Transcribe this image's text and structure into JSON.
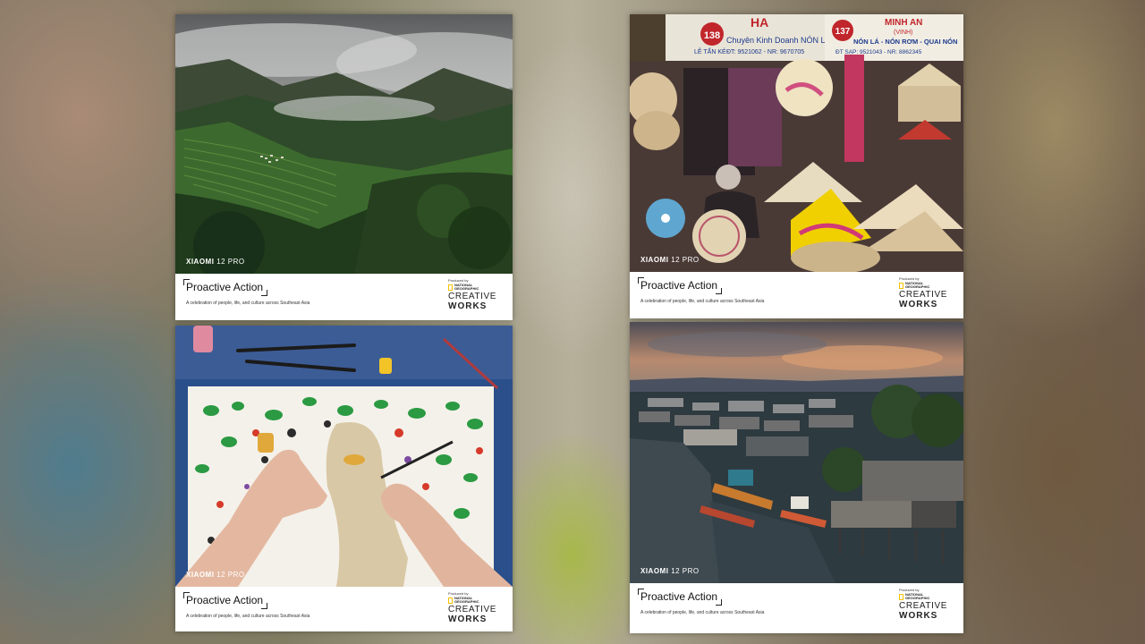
{
  "cards": [
    {
      "watermark_brand": "XIAOMI",
      "watermark_model": "12 PRO",
      "title": "Proactive Action",
      "tagline": "A celebration of people, life, and culture across Southeast Asia",
      "produced_by": "Produced by",
      "ng_line1": "NATIONAL",
      "ng_line2": "GEOGRAPHIC",
      "creative": "CREATIVE",
      "works": "WORKS"
    },
    {
      "watermark_brand": "XIAOMI",
      "watermark_model": "12 PRO",
      "title": "Proactive Action",
      "tagline": "A celebration of people, life, and culture across Southeast Asia",
      "produced_by": "Produced by",
      "ng_line1": "NATIONAL",
      "ng_line2": "GEOGRAPHIC",
      "creative": "CREATIVE",
      "works": "WORKS",
      "signs": {
        "num_left": "138",
        "num_right": "137",
        "shop_left_top": "HA",
        "shop_left": "Chuyên Kinh Doanh NÓN LÁ",
        "shop_left_sub": "LÊ TẤN KÉ",
        "phone_left": "ĐT: 9521062 - NR: 9670705",
        "shop_right_top": "MINH AN",
        "shop_right_paren": "(VINH)",
        "shop_right": "NÓN LÁ - NÓN RƠM - QUAI NÓN",
        "phone_right": "ĐT SẠP: 9521043 - NR: 8862345"
      }
    },
    {
      "watermark_brand": "XIAOMI",
      "watermark_model": "12 PRO",
      "title": "Proactive Action",
      "tagline": "A celebration of people, life, and culture across Southeast Asia",
      "produced_by": "Produced by",
      "ng_line1": "NATIONAL",
      "ng_line2": "GEOGRAPHIC",
      "creative": "CREATIVE",
      "works": "WORKS"
    },
    {
      "watermark_brand": "XIAOMI",
      "watermark_model": "12 PRO",
      "title": "Proactive Action",
      "tagline": "A celebration of people, life, and culture across Southeast Asia",
      "produced_by": "Produced by",
      "ng_line1": "NATIONAL",
      "ng_line2": "GEOGRAPHIC",
      "creative": "CREATIVE",
      "works": "WORKS"
    }
  ],
  "colors": {
    "ng_yellow": "#f6c200",
    "footer_bg": "#ffffff"
  }
}
